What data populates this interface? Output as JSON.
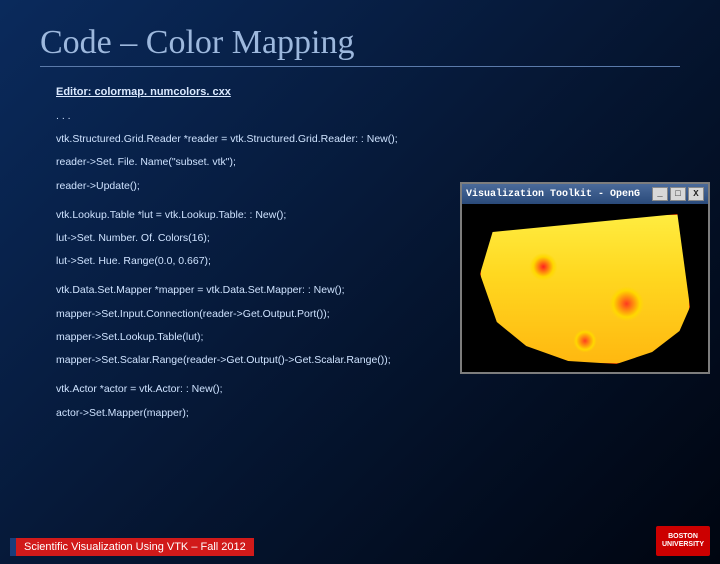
{
  "title": "Code – Color Mapping",
  "editor_label": "Editor: colormap. numcolors. cxx",
  "code": {
    "ell": ". . .",
    "l1": "vtk.Structured.Grid.Reader *reader = vtk.Structured.Grid.Reader: : New();",
    "l2": "reader->Set. File. Name(\"subset. vtk\");",
    "l3": "reader->Update();",
    "l4": "vtk.Lookup.Table *lut = vtk.Lookup.Table: : New();",
    "l5": "lut->Set. Number. Of. Colors(16);",
    "l6": "lut->Set. Hue. Range(0.0, 0.667);",
    "l7": "vtk.Data.Set.Mapper *mapper = vtk.Data.Set.Mapper: : New();",
    "l8": "mapper->Set.Input.Connection(reader->Get.Output.Port());",
    "l9": "mapper->Set.Lookup.Table(lut);",
    "l10": "mapper->Set.Scalar.Range(reader->Get.Output()->Get.Scalar.Range());",
    "l11": "vtk.Actor *actor = vtk.Actor: : New();",
    "l12": "actor->Set.Mapper(mapper);"
  },
  "footer": "Scientific Visualization Using VTK – Fall 2012",
  "logo": {
    "line1": "BOSTON",
    "line2": "UNIVERSITY"
  },
  "render": {
    "title": "Visualization Toolkit - OpenG",
    "min": "_",
    "max": "□",
    "close": "X"
  }
}
